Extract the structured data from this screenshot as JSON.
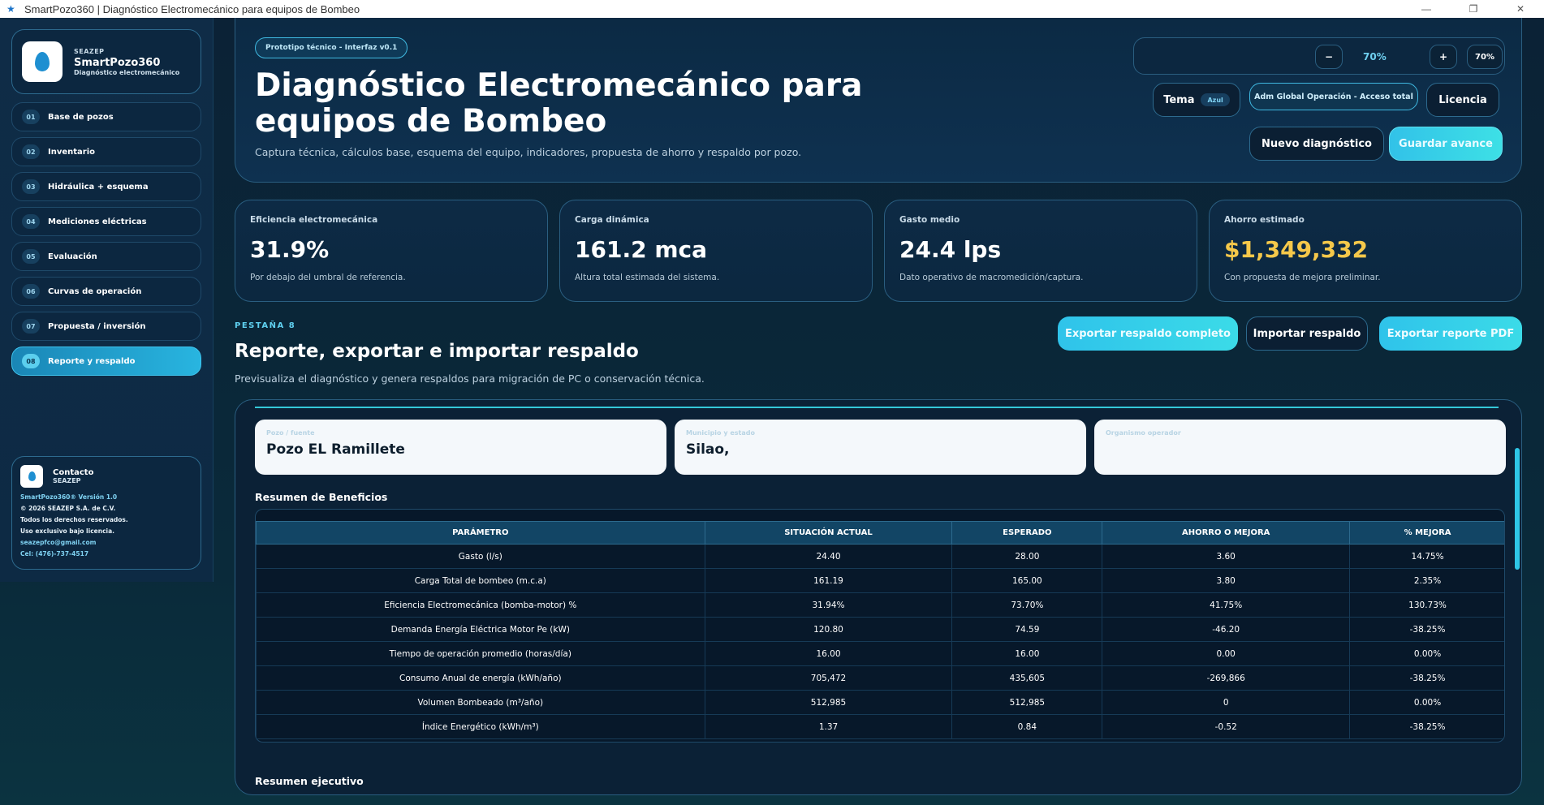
{
  "window": {
    "title": "SmartPozo360 | Diagnóstico Electromecánico para equipos de Bombeo",
    "minimize": "—",
    "maximize": "❐",
    "close": "✕"
  },
  "brand": {
    "tag": "SEAZEP",
    "name": "SmartPozo360",
    "subtitle": "Diagnóstico electromecánico"
  },
  "nav": [
    {
      "num": "01",
      "label": "Base de pozos"
    },
    {
      "num": "02",
      "label": "Inventario"
    },
    {
      "num": "03",
      "label": "Hidráulica + esquema"
    },
    {
      "num": "04",
      "label": "Mediciones eléctricas"
    },
    {
      "num": "05",
      "label": "Evaluación"
    },
    {
      "num": "06",
      "label": "Curvas de operación"
    },
    {
      "num": "07",
      "label": "Propuesta / inversión"
    },
    {
      "num": "08",
      "label": "Reporte y respaldo"
    }
  ],
  "contact": {
    "title": "Contacto",
    "org": "SEAZEP",
    "version": "SmartPozo360® Versión 1.0",
    "copyright": "© 2026 SEAZEP S.A. de C.V.",
    "rights": "Todos los derechos reservados.",
    "license": "Uso exclusivo bajo licencia.",
    "email": "seazepfco@gmail.com",
    "phone": "Cel: (476)-737-4517"
  },
  "header": {
    "badge": "Prototipo técnico - Interfaz v0.1",
    "title": "Diagnóstico Electromecánico para equipos de Bombeo",
    "subtitle": "Captura técnica, cálculos base, esquema del equipo, indicadores, propuesta de ahorro y respaldo por pozo.",
    "zoom": {
      "minus": "−",
      "value": "70%",
      "plus": "+",
      "select": "70%"
    },
    "tema_label": "Tema",
    "tema_value": "Azul",
    "role": "Adm Global Operación - Acceso total",
    "licencia": "Licencia",
    "nuevo": "Nuevo diagnóstico",
    "guardar": "Guardar avance"
  },
  "kpis": [
    {
      "label": "Eficiencia electromecánica",
      "value": "31.9%",
      "note": "Por debajo del umbral de referencia."
    },
    {
      "label": "Carga dinámica",
      "value": "161.2 mca",
      "note": "Altura total estimada del sistema."
    },
    {
      "label": "Gasto medio",
      "value": "24.4 lps",
      "note": "Dato operativo de macromedición/captura."
    },
    {
      "label": "Ahorro estimado",
      "value": "$1,349,332",
      "note": "Con propuesta de mejora preliminar."
    }
  ],
  "section": {
    "tag": "PESTAÑA 8",
    "title": "Reporte, exportar e importar respaldo",
    "subtitle": "Previsualiza el diagnóstico y genera respaldos para migración de PC o conservación técnica.",
    "export_full": "Exportar respaldo completo",
    "import": "Importar respaldo",
    "export_pdf": "Exportar reporte PDF"
  },
  "report": {
    "fields": [
      {
        "label": "Pozo / fuente",
        "value": "Pozo EL Ramillete"
      },
      {
        "label": "Municipio y estado",
        "value": "Silao,"
      },
      {
        "label": "Organismo operador",
        "value": ""
      }
    ],
    "table_title": "Resumen de Beneficios",
    "columns": [
      "PARÁMETRO",
      "SITUACIÓN ACTUAL",
      "ESPERADO",
      "AHORRO O MEJORA",
      "% MEJORA"
    ],
    "rows": [
      [
        "Gasto (l/s)",
        "24.40",
        "28.00",
        "3.60",
        "14.75%"
      ],
      [
        "Carga Total de bombeo (m.c.a)",
        "161.19",
        "165.00",
        "3.80",
        "2.35%"
      ],
      [
        "Eficiencia Electromecánica (bomba-motor) %",
        "31.94%",
        "73.70%",
        "41.75%",
        "130.73%"
      ],
      [
        "Demanda Energía Eléctrica Motor Pe (kW)",
        "120.80",
        "74.59",
        "-46.20",
        "-38.25%"
      ],
      [
        "Tiempo de operación promedio (horas/día)",
        "16.00",
        "16.00",
        "0.00",
        "0.00%"
      ],
      [
        "Consumo Anual de energía (kWh/año)",
        "705,472",
        "435,605",
        "-269,866",
        "-38.25%"
      ],
      [
        "Volumen Bombeado (m³/año)",
        "512,985",
        "512,985",
        "0",
        "0.00%"
      ],
      [
        "Índice Energético (kWh/m³)",
        "1.37",
        "0.84",
        "-0.52",
        "-38.25%"
      ]
    ],
    "exec_title": "Resumen ejecutivo"
  }
}
